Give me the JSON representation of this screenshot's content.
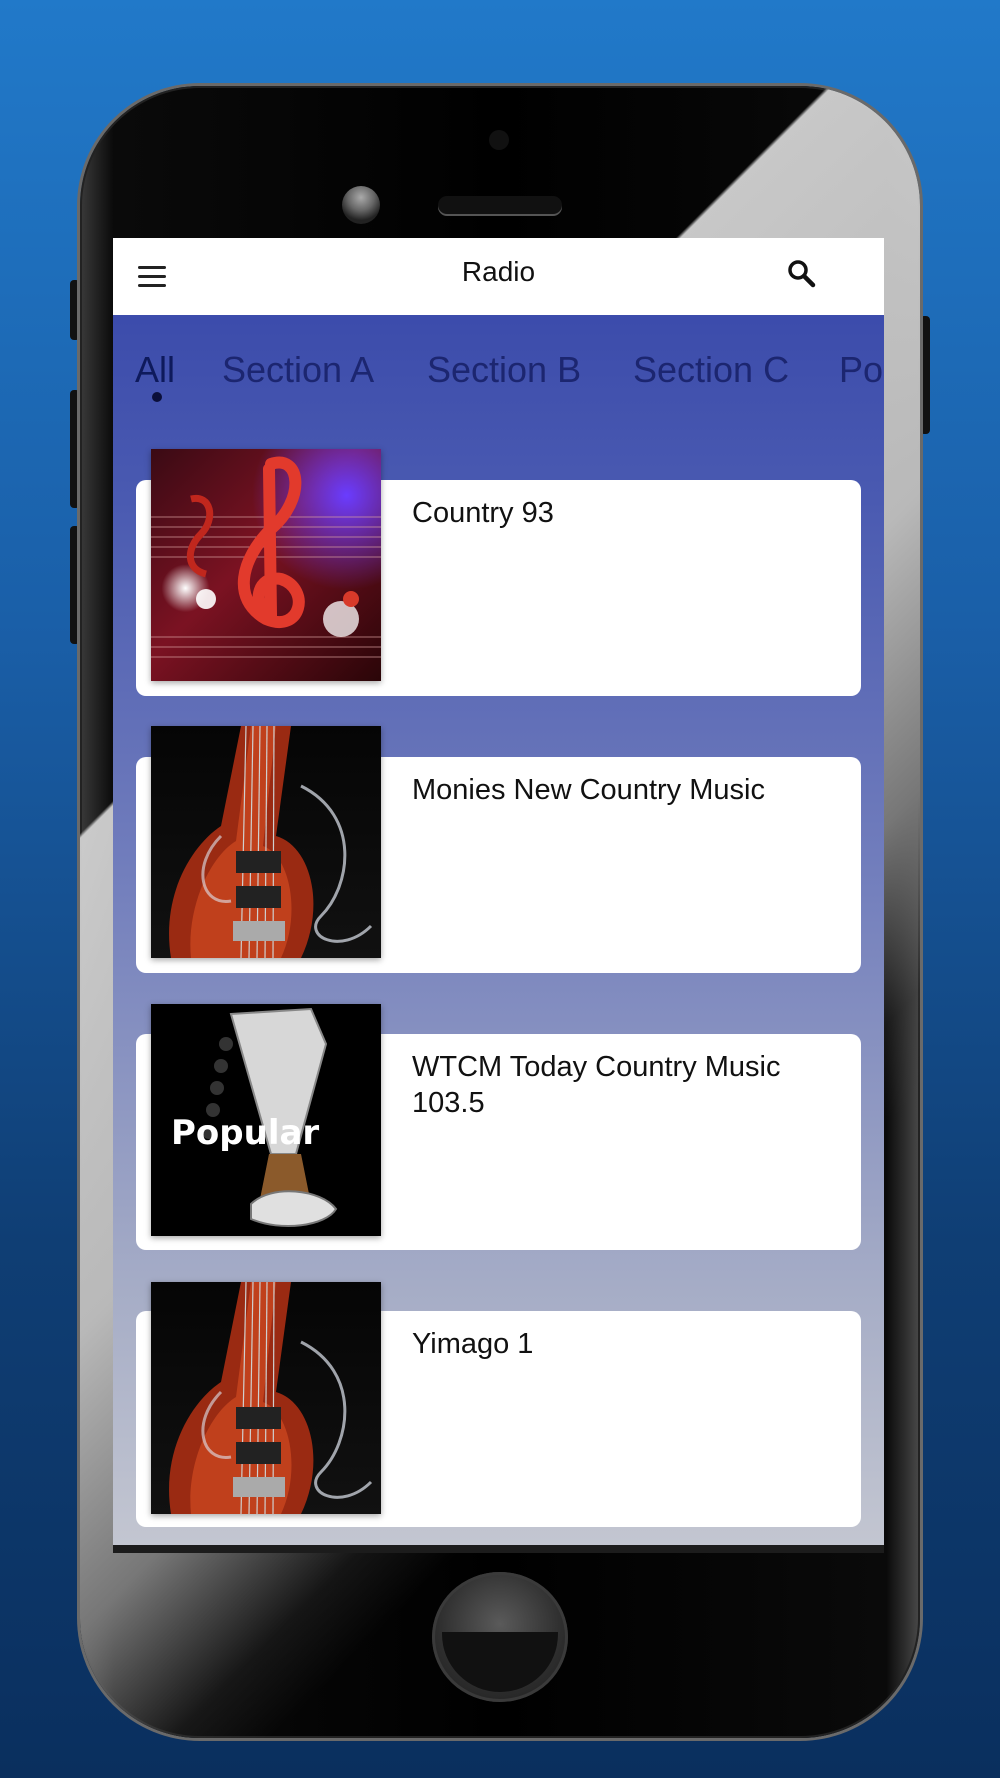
{
  "app": {
    "title": "Radio"
  },
  "tabs": [
    {
      "label": "All",
      "active": true
    },
    {
      "label": "Section A",
      "active": false
    },
    {
      "label": "Section B",
      "active": false
    },
    {
      "label": "Section C",
      "active": false
    },
    {
      "label": "Po",
      "active": false
    }
  ],
  "stations": [
    {
      "name": "Country 93",
      "image": "treble-clef-music-notes"
    },
    {
      "name": "Monies New Country Music",
      "image": "red-electric-guitar-smoke"
    },
    {
      "name": "WTCM Today Country Music 103.5",
      "image": "guitar-headstock-popular",
      "image_caption": "Popular"
    },
    {
      "name": "Yimago 1",
      "image": "red-electric-guitar-smoke"
    }
  ],
  "icons": {
    "menu": "hamburger-menu-icon",
    "search": "search-icon"
  },
  "colors": {
    "background": "#1f6fc0",
    "appbar": "#ffffff",
    "tab_text": "#1c2670",
    "card": "#ffffff"
  }
}
